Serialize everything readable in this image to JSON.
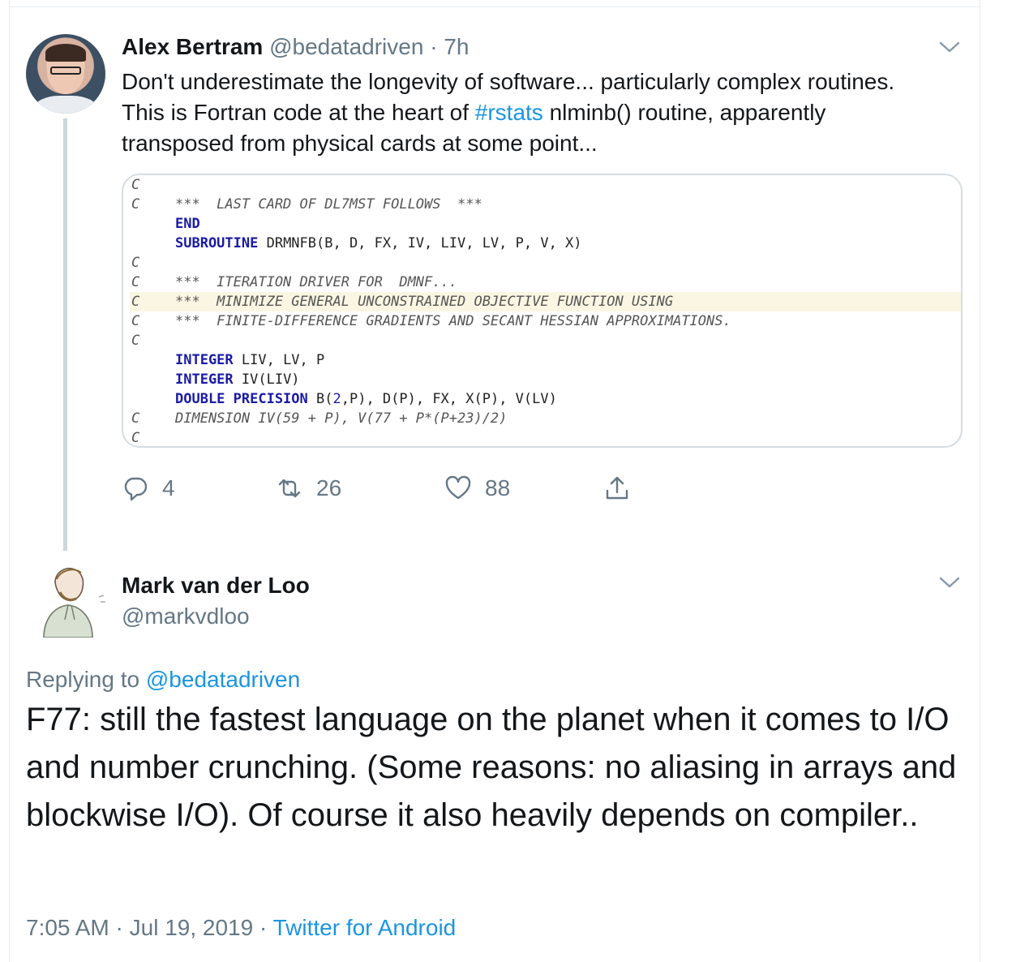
{
  "parent_tweet": {
    "name": "Alex Bertram",
    "handle": "@bedatadriven",
    "separator": "·",
    "time": "7h",
    "text_before": "Don't underestimate the longevity of software... particularly complex routines.  This is Fortran code at the heart of ",
    "hashtag": "#rstats",
    "text_after": " nlminb() routine, apparently transposed from physical cards at some point...",
    "code_image": {
      "lines": [
        {
          "gutter": "C",
          "segments": [
            {
              "t": "plain",
              "v": ""
            }
          ],
          "green": false,
          "highlight": false
        },
        {
          "gutter": "C",
          "segments": [
            {
              "t": "cmt",
              "v": "***  LAST CARD OF DL7MST FOLLOWS  ***"
            }
          ],
          "green": false,
          "highlight": false
        },
        {
          "gutter": "",
          "segments": [
            {
              "t": "kw",
              "v": "END"
            }
          ],
          "green": true,
          "highlight": false
        },
        {
          "gutter": "",
          "segments": [
            {
              "t": "kw",
              "v": "SUBROUTINE"
            },
            {
              "t": "plain",
              "v": " DRMNFB(B, D, FX, IV, LIV, LV, P, V, X)"
            }
          ],
          "green": true,
          "highlight": false
        },
        {
          "gutter": "C",
          "segments": [
            {
              "t": "plain",
              "v": ""
            }
          ],
          "green": false,
          "highlight": false
        },
        {
          "gutter": "C",
          "segments": [
            {
              "t": "cmt",
              "v": "***  ITERATION DRIVER FOR  DMNF..."
            }
          ],
          "green": false,
          "highlight": false
        },
        {
          "gutter": "C",
          "segments": [
            {
              "t": "cmt",
              "v": "***  MINIMIZE GENERAL UNCONSTRAINED OBJECTIVE FUNCTION USING"
            }
          ],
          "green": false,
          "highlight": true
        },
        {
          "gutter": "C",
          "segments": [
            {
              "t": "cmt",
              "v": "***  FINITE-DIFFERENCE GRADIENTS AND SECANT HESSIAN APPROXIMATIONS."
            }
          ],
          "green": false,
          "highlight": false
        },
        {
          "gutter": "C",
          "segments": [
            {
              "t": "plain",
              "v": ""
            }
          ],
          "green": false,
          "highlight": false
        },
        {
          "gutter": "",
          "segments": [
            {
              "t": "kw",
              "v": "INTEGER"
            },
            {
              "t": "plain",
              "v": " LIV, LV, P"
            }
          ],
          "green": true,
          "highlight": false
        },
        {
          "gutter": "",
          "segments": [
            {
              "t": "kw",
              "v": "INTEGER"
            },
            {
              "t": "plain",
              "v": " IV(LIV)"
            }
          ],
          "green": true,
          "highlight": false
        },
        {
          "gutter": "",
          "segments": [
            {
              "t": "kw",
              "v": "DOUBLE PRECISION"
            },
            {
              "t": "plain",
              "v": " B("
            },
            {
              "t": "num",
              "v": "2"
            },
            {
              "t": "plain",
              "v": ",P), D(P), FX, X(P), V(LV)"
            }
          ],
          "green": true,
          "highlight": false
        },
        {
          "gutter": "C",
          "segments": [
            {
              "t": "cmt",
              "v": "DIMENSION IV(59 + P), V(77 + P*(P+23)/2)"
            }
          ],
          "green": false,
          "highlight": false
        },
        {
          "gutter": "C",
          "segments": [
            {
              "t": "plain",
              "v": ""
            }
          ],
          "green": false,
          "highlight": false
        }
      ]
    },
    "actions": {
      "reply_count": "4",
      "retweet_count": "26",
      "like_count": "88"
    }
  },
  "reply_tweet": {
    "name": "Mark van der Loo",
    "handle": "@markvdloo",
    "replying_label": "Replying to",
    "replying_to": "@bedatadriven",
    "text": "F77: still the fastest language on the planet when it comes to I/O and number crunching. (Some reasons: no aliasing in arrays and blockwise I/O). Of course it also heavily depends on compiler..",
    "time": "7:05 AM",
    "date": "Jul 19, 2019",
    "separator": "·",
    "source": "Twitter for Android"
  },
  "colors": {
    "link": "#1b95e0",
    "muted": "#657786",
    "text": "#14171a",
    "border": "#e6ecf0"
  }
}
